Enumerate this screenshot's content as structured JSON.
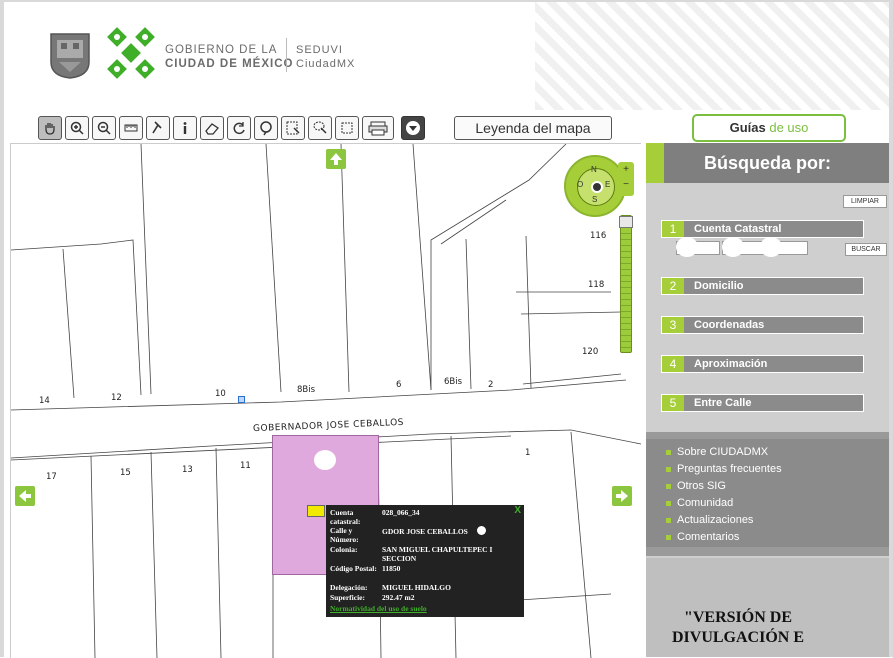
{
  "header": {
    "gov_line1": "GOBIERNO DE LA",
    "gov_line2": "CIUDAD DE MÉXICO",
    "agency": "SEDUVI",
    "agency_sub": "CiudadMX"
  },
  "toolbar": {
    "tools": [
      "pan-hand-icon",
      "zoom-in-icon",
      "zoom-out-icon",
      "measure-ruler-icon",
      "pin-icon",
      "info-icon",
      "eraser-icon",
      "rotate-left-icon",
      "rotate-right-icon",
      "select-rect-icon",
      "select-lasso-icon",
      "select-area-icon",
      "print-icon",
      "download-icon"
    ],
    "legend_label": "Leyenda del mapa",
    "guides_label_a": "Guías",
    "guides_label_b": "de uso"
  },
  "map": {
    "street": "GOBERNADOR JOSE CEBALLOS",
    "compass": {
      "n": "N",
      "s": "S",
      "e": "E",
      "o": "O"
    },
    "zoom_plus": "+",
    "zoom_minus": "−",
    "lot_numbers": [
      "116",
      "118",
      "120",
      "14",
      "12",
      "10",
      "8Bis",
      "6",
      "6Bis",
      "2",
      "17",
      "15",
      "13",
      "11",
      "1"
    ]
  },
  "popup": {
    "close": "X",
    "cuenta_k": "Cuenta catastral:",
    "cuenta_v": "028_066_34",
    "calle_k": "Calle y Número:",
    "calle_v": "GDOR JOSE CEBALLOS",
    "colonia_k": "Colonia:",
    "colonia_v": "SAN MIGUEL CHAPULTEPEC I SECCION",
    "cp_k": "Código Postal:",
    "cp_v": "11850",
    "deleg_k": "Delegación:",
    "deleg_v": "MIGUEL HIDALGO",
    "sup_k": "Superficie:",
    "sup_v": "292.47 m2",
    "link": "Normatividad del uso de suelo"
  },
  "panel": {
    "title": "Búsqueda por:",
    "clear": "LIMPIAR",
    "search": "BUSCAR",
    "items": [
      {
        "n": "1",
        "label": "Cuenta Catastral"
      },
      {
        "n": "2",
        "label": "Domicilio"
      },
      {
        "n": "3",
        "label": "Coordenadas"
      },
      {
        "n": "4",
        "label": "Aproximación"
      },
      {
        "n": "5",
        "label": "Entre Calle"
      }
    ],
    "links": [
      "Sobre CIUDADMX",
      "Preguntas frecuentes",
      "Otros SIG",
      "Comunidad",
      "Actualizaciones",
      "Comentarios"
    ]
  },
  "footer_note": {
    "line1": "\"VERSIÓN DE",
    "line2": "DIVULGACIÓN E"
  },
  "colors": {
    "accent": "#a6ce39",
    "panel": "#8b8b8b",
    "lot": "#dfa9dd"
  }
}
